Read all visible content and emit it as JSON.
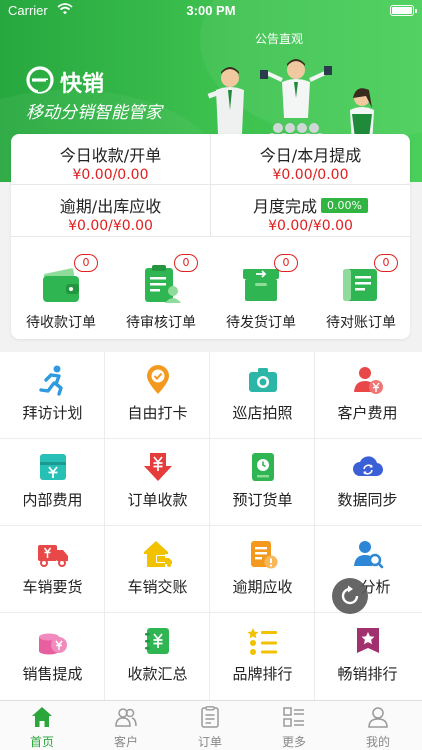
{
  "status_bar": {
    "carrier": "Carrier",
    "time": "3:00 PM"
  },
  "header": {
    "notice": "公告直观"
  },
  "banner": {
    "brand": "快销",
    "slogan": "移动分销智能管家"
  },
  "stats": [
    {
      "label": "今日收款/开单",
      "value": "¥0.00/0.00"
    },
    {
      "label": "今日/本月提成",
      "value": "¥0.00/0.00"
    },
    {
      "label": "逾期/出库应收",
      "value": "¥0.00/¥0.00"
    },
    {
      "label": "月度完成",
      "badge": "0.00%",
      "value": "¥0.00/¥0.00"
    }
  ],
  "orders": [
    {
      "label": "待收款订单",
      "count": "0",
      "icon": "wallet-icon"
    },
    {
      "label": "待审核订单",
      "count": "0",
      "icon": "clipboard-user-icon"
    },
    {
      "label": "待发货订单",
      "count": "0",
      "icon": "box-arrow-icon"
    },
    {
      "label": "待对账订单",
      "count": "0",
      "icon": "ledger-icon"
    }
  ],
  "grid": [
    {
      "label": "拜访计划",
      "icon": "running-person-icon",
      "color": "#2e9be0"
    },
    {
      "label": "自由打卡",
      "icon": "location-pin-icon",
      "color": "#f39a1e"
    },
    {
      "label": "巡店拍照",
      "icon": "camera-icon",
      "color": "#2cb6a8"
    },
    {
      "label": "客户费用",
      "icon": "customer-yen-icon",
      "color": "#e94848"
    },
    {
      "label": "内部费用",
      "icon": "yen-card-icon",
      "color": "#27c0b6"
    },
    {
      "label": "订单收款",
      "icon": "yen-down-arrow-icon",
      "color": "#e63c3c"
    },
    {
      "label": "预订货单",
      "icon": "clock-doc-icon",
      "color": "#2fb552"
    },
    {
      "label": "数据同步",
      "icon": "cloud-sync-icon",
      "color": "#3a5fd6"
    },
    {
      "label": "车销要货",
      "icon": "truck-yen-icon",
      "color": "#e94848"
    },
    {
      "label": "车销交账",
      "icon": "home-truck-icon",
      "color": "#f2c200"
    },
    {
      "label": "逾期应收",
      "icon": "overdue-doc-icon",
      "color": "#f39a1e"
    },
    {
      "label": "分析",
      "icon": "search-user-icon",
      "color": "#2e86d6"
    },
    {
      "label": "销售提成",
      "icon": "coin-stack-icon",
      "color": "#e85fa0"
    },
    {
      "label": "收款汇总",
      "icon": "notebook-yen-icon",
      "color": "#2fb552"
    },
    {
      "label": "品牌排行",
      "icon": "star-list-icon",
      "color": "#f2c200"
    },
    {
      "label": "畅销排行",
      "icon": "star-shield-icon",
      "color": "#a1316e"
    }
  ],
  "tabs": [
    {
      "label": "首页",
      "icon": "home-icon"
    },
    {
      "label": "客户",
      "icon": "customers-icon"
    },
    {
      "label": "订单",
      "icon": "order-doc-icon"
    },
    {
      "label": "更多",
      "icon": "grid-list-icon"
    },
    {
      "label": "我的",
      "icon": "profile-icon"
    }
  ],
  "colors": {
    "brand": "#2aa63b",
    "alert": "#e02020"
  }
}
